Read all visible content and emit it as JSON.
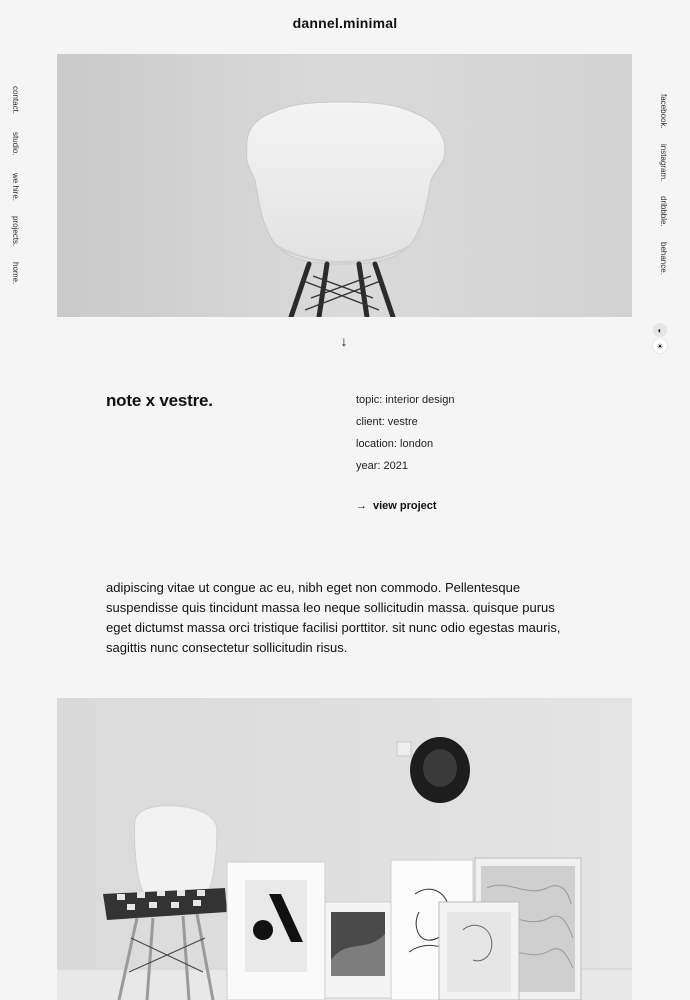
{
  "header": {
    "brand": "dannel.minimal"
  },
  "side_nav": {
    "items": [
      {
        "label": "home."
      },
      {
        "label": "projects."
      },
      {
        "label": "we hire."
      },
      {
        "label": "studio."
      },
      {
        "label": "contact."
      }
    ]
  },
  "social": {
    "items": [
      {
        "label": "facebook."
      },
      {
        "label": "instagram."
      },
      {
        "label": "dribbble."
      },
      {
        "label": "behance."
      }
    ]
  },
  "hero": {
    "image": "white-chair-photo"
  },
  "scroll_icon": "arrow-down-icon",
  "project": {
    "title": "note x vestre.",
    "meta": [
      "topic: interior design",
      "client: vestre",
      "location: london",
      "year: 2021"
    ],
    "view_label": "view project",
    "view_icon": "arrow-right-icon"
  },
  "description": "adipiscing vitae ut congue ac eu, nibh eget non commodo. Pellentesque suspendisse quis tincidunt massa leo neque sollicitudin massa. quisque purus eget dictumst massa orci tristique facilisi porttitor. sit nunc odio egestas mauris, sagittis nunc consectetur sollicitudin risus.",
  "theme_toggle": {
    "dark_icon": "moon-icon",
    "light_icon": "sun-icon",
    "active": "light"
  },
  "gallery": {
    "image": "chair-frames-interior-photo"
  }
}
